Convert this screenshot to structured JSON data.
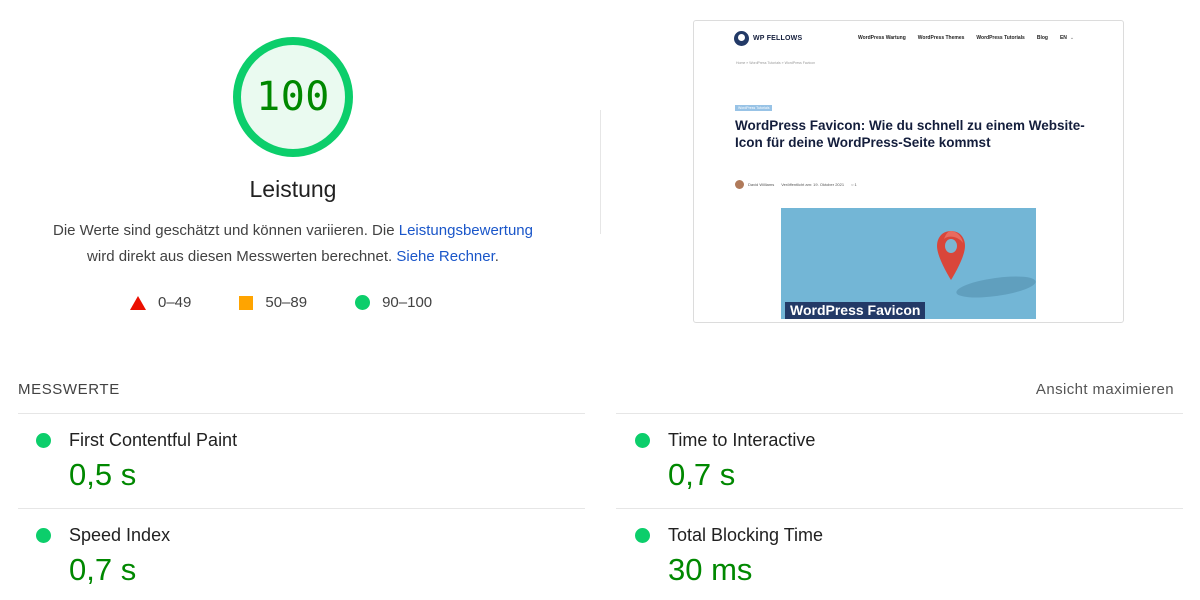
{
  "score": {
    "value": "100",
    "fraction": 1.0,
    "ring_color": "#0cce6b",
    "fill_color": "#eafaf0",
    "text_color": "#008800"
  },
  "title": "Leistung",
  "description": {
    "text1": "Die Werte sind geschätzt und können variieren. Die ",
    "link1": "Leistungsbewertung",
    "text2": "wird direkt aus diesen Messwerten berechnet. ",
    "link2": "Siehe Rechner",
    "text3": "."
  },
  "legend": [
    {
      "icon": "triangle-icon",
      "label": "0–49",
      "color": "#eb0f00"
    },
    {
      "icon": "square-icon",
      "label": "50–89",
      "color": "#ffa400"
    },
    {
      "icon": "circle-icon",
      "label": "90–100",
      "color": "#0cce6b"
    }
  ],
  "thumbnail": {
    "logo_text": "WP FELLOWS",
    "nav": [
      "WordPress Wartung",
      "WordPress Themes",
      "WordPress Tutorials",
      "Blog",
      "EN"
    ],
    "breadcrumb": "Home » WordPress Tutorials » WordPress Favicon",
    "category": "WordPress Tutorials",
    "article_title": "WordPress Favicon: Wie du schnell zu einem Website-Icon für deine WordPress-Seite kommst",
    "author": "David Williams",
    "date": "Veröffentlicht am: 19. Oktober 2021",
    "comments": "1",
    "image_caption": "WordPress Favicon"
  },
  "metrics": {
    "heading": "MESSWERTE",
    "expand_label": "Ansicht maximieren",
    "items": [
      {
        "name": "First Contentful Paint",
        "value": "0,5 s"
      },
      {
        "name": "Time to Interactive",
        "value": "0,7 s"
      },
      {
        "name": "Speed Index",
        "value": "0,7 s"
      },
      {
        "name": "Total Blocking Time",
        "value": "30 ms"
      }
    ]
  }
}
